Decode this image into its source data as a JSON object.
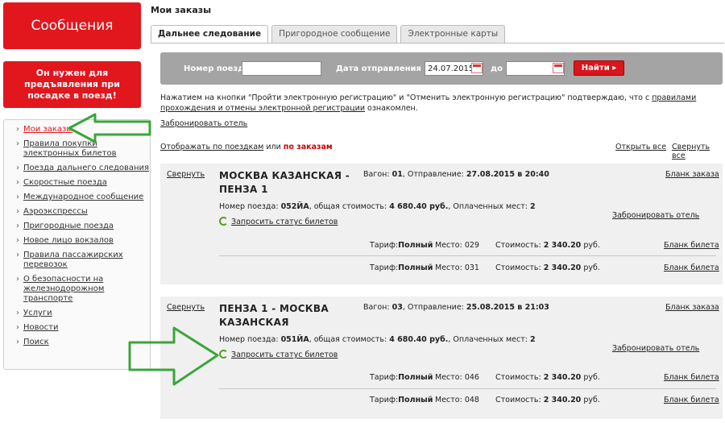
{
  "sidebar": {
    "messages_label": "Сообщения",
    "promo_text": "Он нужен для предъявления при посадке в поезд!",
    "items": [
      {
        "label": "Мои заказы",
        "active": true
      },
      {
        "label": "Правила покупки электронных билетов"
      },
      {
        "label": "Поезда дальнего следования"
      },
      {
        "label": "Скоростные поезда"
      },
      {
        "label": "Международное сообщение"
      },
      {
        "label": "Аэроэкспрессы"
      },
      {
        "label": "Пригородные поезда"
      },
      {
        "label": "Новое лицо вокзалов"
      },
      {
        "label": "Правила пассажирских перевозок"
      },
      {
        "label": "О безопасности на железнодорожном транспорте"
      },
      {
        "label": "Услуги"
      },
      {
        "label": "Новости"
      },
      {
        "label": "Поиск"
      }
    ]
  },
  "page": {
    "title": "Мои заказы"
  },
  "tabs": [
    {
      "label": "Дальнее следование",
      "active": true
    },
    {
      "label": "Пригородное сообщение"
    },
    {
      "label": "Электронные карты"
    }
  ],
  "search": {
    "train_label": "Номер поезда",
    "train_value": "",
    "date_from_label": "Дата отправления от",
    "date_from_value": "24.07.2015",
    "date_to_label": "до",
    "date_to_value": "",
    "find_label": "Найти ▸"
  },
  "info": {
    "text": "Нажатием на кнопки \"Пройти электронную регистрацию\" и \"Отменить электронную регистрацию\" подтверждаю, что с ",
    "link": "правилами прохождения и отмены электронной регистрации",
    "text_end": " ознакомлен.",
    "book_hotel": "Забронировать отель"
  },
  "display": {
    "by_trips": "Отображать по поездкам",
    "or": " или ",
    "by_orders": "по заказам",
    "expand_all": "Открыть все",
    "collapse_all": "Свернуть все"
  },
  "orders": [
    {
      "collapse": "Свернуть",
      "route": "МОСКВА КАЗАНСКАЯ - ПЕНЗА 1",
      "wagon_label": "Вагон: ",
      "wagon": "01",
      "departure_label": ", Отправление: ",
      "departure": "27.08.2015 в 20:40",
      "form_link": "Бланк заказа",
      "train_label": "Номер поезда: ",
      "train": "052ЙА",
      "cost_label": ", общая стоимость: ",
      "cost": "4 680.40 руб.",
      "paid_label": ", Оплаченных мест: ",
      "paid": "2",
      "status_link": "Запросить статус билетов",
      "hotel_link": "Забронировать отель",
      "tickets": [
        {
          "tariff_label": "Тариф:",
          "tariff": "Полный",
          "seat_label": "Место: ",
          "seat": "029",
          "price_label": "Стоимость: ",
          "price": "2 340.20",
          "currency": " руб.",
          "link": "Бланк билета"
        },
        {
          "tariff_label": "Тариф:",
          "tariff": "Полный",
          "seat_label": "Место: ",
          "seat": "031",
          "price_label": "Стоимость: ",
          "price": "2 340.20",
          "currency": " руб.",
          "link": "Бланк билета"
        }
      ]
    },
    {
      "collapse": "Свернуть",
      "route": "ПЕНЗА 1 - МОСКВА КАЗАНСКАЯ",
      "wagon_label": "Вагон: ",
      "wagon": "03",
      "departure_label": ", Отправление: ",
      "departure": "25.08.2015 в 21:03",
      "form_link": "Бланк заказа",
      "train_label": "Номер поезда: ",
      "train": "051ЙА",
      "cost_label": ", общая стоимость: ",
      "cost": "4 680.40 руб.",
      "paid_label": ", Оплаченных мест: ",
      "paid": "2",
      "status_link": "Запросить статус билетов",
      "hotel_link": "Забронировать отель",
      "tickets": [
        {
          "tariff_label": "Тариф:",
          "tariff": "Полный",
          "seat_label": "Место: ",
          "seat": "046",
          "price_label": "Стоимость: ",
          "price": "2 340.20",
          "currency": " руб.",
          "link": "Бланк билета"
        },
        {
          "tariff_label": "Тариф:",
          "tariff": "Полный",
          "seat_label": "Место: ",
          "seat": "048",
          "price_label": "Стоимость: ",
          "price": "2 340.20",
          "currency": " руб.",
          "link": "Бланк билета"
        }
      ]
    }
  ],
  "colors": {
    "accent_red": "#e2161d",
    "annotation_green": "#3aa63a",
    "refresh_green": "#5a9b2a"
  },
  "icons": [
    "calendar-icon",
    "refresh-icon",
    "annotation-arrow-icon"
  ]
}
